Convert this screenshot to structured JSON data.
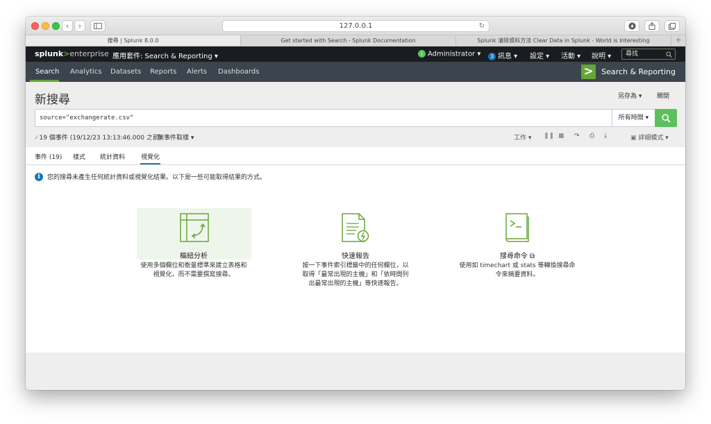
{
  "browser": {
    "url": "127.0.0.1",
    "tabs": [
      "搜尋 | Splunk 8.0.0",
      "Get started with Search - Splunk Documentation",
      "Splunk 清除資料方法 Clear Data in Splunk - World is Interesting"
    ]
  },
  "appbar": {
    "logo_main": "splunk",
    "logo_gt": ">",
    "logo_sub": "enterprise",
    "app_menu": "應用套件: Search & Reporting ▾",
    "user": "Administrator ▾",
    "messages_count": "3",
    "messages": "訊息 ▾",
    "settings": "設定 ▾",
    "activity": "活動 ▾",
    "help": "說明 ▾",
    "find_placeholder": "尋找"
  },
  "navbar": {
    "items": [
      "Search",
      "Analytics",
      "Datasets",
      "Reports",
      "Alerts",
      "Dashboards"
    ],
    "app_title": "Search & Reporting"
  },
  "page": {
    "title": "新搜尋",
    "save_as": "另存為 ▾",
    "close": "關閉",
    "query": "source=\"exchangerate.csv\"",
    "time_range": "所有時間 ▾",
    "status": "19 個事件 (19/12/23 13:13:46.000 之前)",
    "sampling": "無事件取樣 ▾",
    "job": "工作 ▾",
    "mode": "詳細模式 ▾"
  },
  "result_tabs": [
    "事件 (19)",
    "樣式",
    "統計資料",
    "視覺化"
  ],
  "content": {
    "info": "您的搜尋未產生任何統計資料或視覺化結果。以下是一些可能取得結果的方式。",
    "options": [
      {
        "title": "樞紐分析",
        "desc": [
          "使用多個欄位和衡量標準來建立表格和",
          "視覺化，而不需要撰寫搜尋。"
        ]
      },
      {
        "title": "快速報告",
        "desc": [
          "按一下事件索引標籤中的任何欄位，以",
          "取得「最常出現的主機」和「依時間列",
          "出最常出現的主機」等快速報告。"
        ]
      },
      {
        "title": "搜尋命令 ⧉",
        "desc": [
          "使用如 timechart 或 stats 等轉換搜尋命",
          "令來摘要資料。"
        ]
      }
    ]
  },
  "colors": {
    "accent_green": "#65a637",
    "search_button": "#5cc05c",
    "link_blue": "#1a76bb",
    "appbar": "#1a1c20",
    "navbar": "#3c444d"
  }
}
